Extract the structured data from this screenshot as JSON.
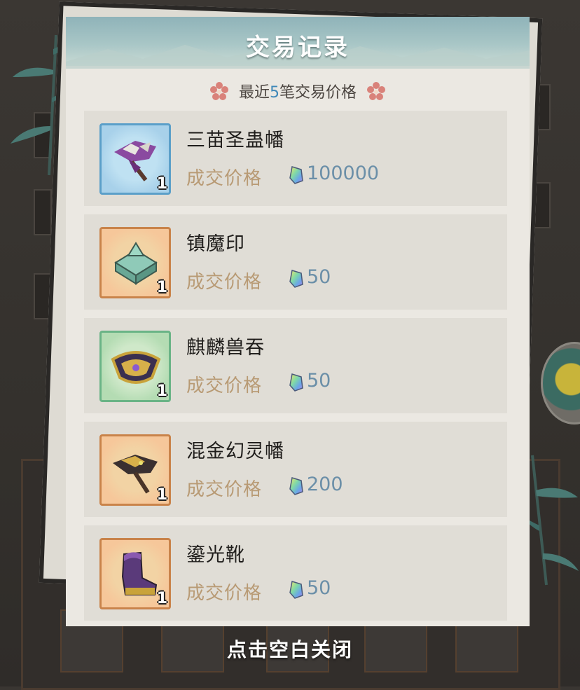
{
  "dialog": {
    "title": "交易记录",
    "subtitle_prefix": "最近",
    "subtitle_count": "5",
    "subtitle_suffix": "笔交易价格"
  },
  "records": [
    {
      "name": "三苗圣蛊幡",
      "price_label": "成交价格",
      "price": "100000",
      "count": "1",
      "rarity": "blue",
      "icon": "banner-icon"
    },
    {
      "name": "镇魔印",
      "price_label": "成交价格",
      "price": "50",
      "count": "1",
      "rarity": "orange",
      "icon": "seal-icon"
    },
    {
      "name": "麒麟兽吞",
      "price_label": "成交价格",
      "price": "50",
      "count": "1",
      "rarity": "green",
      "icon": "beast-armor-icon"
    },
    {
      "name": "混金幻灵幡",
      "price_label": "成交价格",
      "price": "200",
      "count": "1",
      "rarity": "orange",
      "icon": "golden-banner-icon"
    },
    {
      "name": "鎏光靴",
      "price_label": "成交价格",
      "price": "50",
      "count": "1",
      "rarity": "orange",
      "icon": "boot-icon"
    }
  ],
  "currency_icon": "crystal-gem-icon",
  "close_hint": "点击空白关闭",
  "colors": {
    "header": "#8fb3b9",
    "price_label": "#b89a74",
    "price_value": "#6b8fa8",
    "rarity_blue": "#5b9fc9",
    "rarity_orange": "#c9834a",
    "rarity_green": "#6ab486"
  }
}
